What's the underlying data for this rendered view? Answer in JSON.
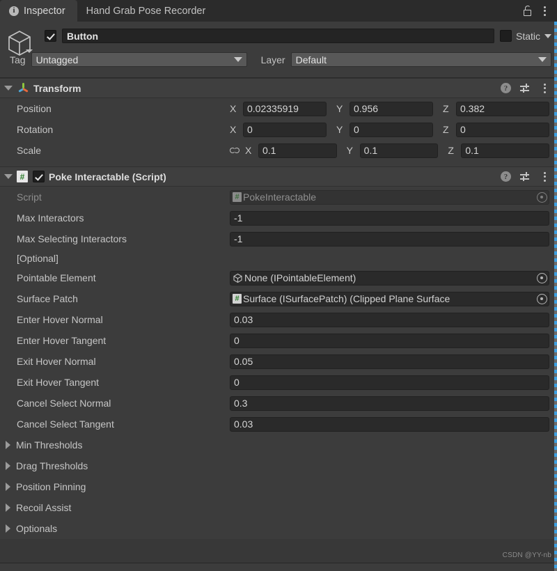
{
  "window": {
    "tabs": [
      {
        "label": "Inspector",
        "icon": "info-icon",
        "active": true
      },
      {
        "label": "Hand Grab Pose Recorder",
        "active": false
      }
    ],
    "lock_icon": "lock-open-icon",
    "menu_icon": "kebab-menu-icon"
  },
  "object_header": {
    "icon": "game-object-cube-icon",
    "enabled_checkbox": true,
    "name": "Button",
    "static_label": "Static",
    "static_checked": false,
    "tag_label": "Tag",
    "tag_value": "Untagged",
    "layer_label": "Layer",
    "layer_value": "Default"
  },
  "transform": {
    "title": "Transform",
    "icon": "transform-gizmo-icon",
    "expanded": true,
    "help_icon": "help-icon",
    "preset_icon": "preset-icon",
    "menu_icon": "kebab-menu-icon",
    "rows": [
      {
        "label": "Position",
        "x": "0.02335919",
        "y": "0.956",
        "z": "0.382",
        "link": false
      },
      {
        "label": "Rotation",
        "x": "0",
        "y": "0",
        "z": "0",
        "link": false
      },
      {
        "label": "Scale",
        "x": "0.1",
        "y": "0.1",
        "z": "0.1",
        "link": true
      }
    ],
    "axis_x": "X",
    "axis_y": "Y",
    "axis_z": "Z"
  },
  "poke_interactable": {
    "title": "Poke Interactable (Script)",
    "icon": "cs-script-icon",
    "enabled_checkbox": true,
    "expanded": true,
    "help_icon": "help-icon",
    "preset_icon": "preset-icon",
    "menu_icon": "kebab-menu-icon",
    "script_row": {
      "label": "Script",
      "value": "PokeInteractable",
      "icon": "cs-script-icon",
      "picker_icon": "object-picker-icon",
      "disabled": true
    },
    "numeric_rows": [
      {
        "label": "Max Interactors",
        "value": "-1"
      },
      {
        "label": "Max Selecting Interactors",
        "value": "-1"
      }
    ],
    "optional_header": "[Optional]",
    "object_rows": [
      {
        "label": "Pointable Element",
        "value": "None (IPointableElement)",
        "icon": "mesh-cube-icon",
        "picker_icon": "object-picker-icon"
      },
      {
        "label": "Surface Patch",
        "value": "Surface (ISurfacePatch) (Clipped Plane Surface",
        "icon": "cs-script-icon",
        "picker_icon": "object-picker-icon"
      }
    ],
    "value_rows": [
      {
        "label": "Enter Hover Normal",
        "value": "0.03"
      },
      {
        "label": "Enter Hover Tangent",
        "value": "0"
      },
      {
        "label": "Exit Hover Normal",
        "value": "0.05"
      },
      {
        "label": "Exit Hover Tangent",
        "value": "0"
      },
      {
        "label": "Cancel Select Normal",
        "value": "0.3"
      },
      {
        "label": "Cancel Select Tangent",
        "value": "0.03"
      }
    ],
    "foldouts": [
      {
        "label": "Min Thresholds"
      },
      {
        "label": "Drag Thresholds"
      },
      {
        "label": "Position Pinning"
      },
      {
        "label": "Recoil Assist"
      },
      {
        "label": "Optionals"
      }
    ]
  },
  "watermark": "CSDN @YY-nb"
}
